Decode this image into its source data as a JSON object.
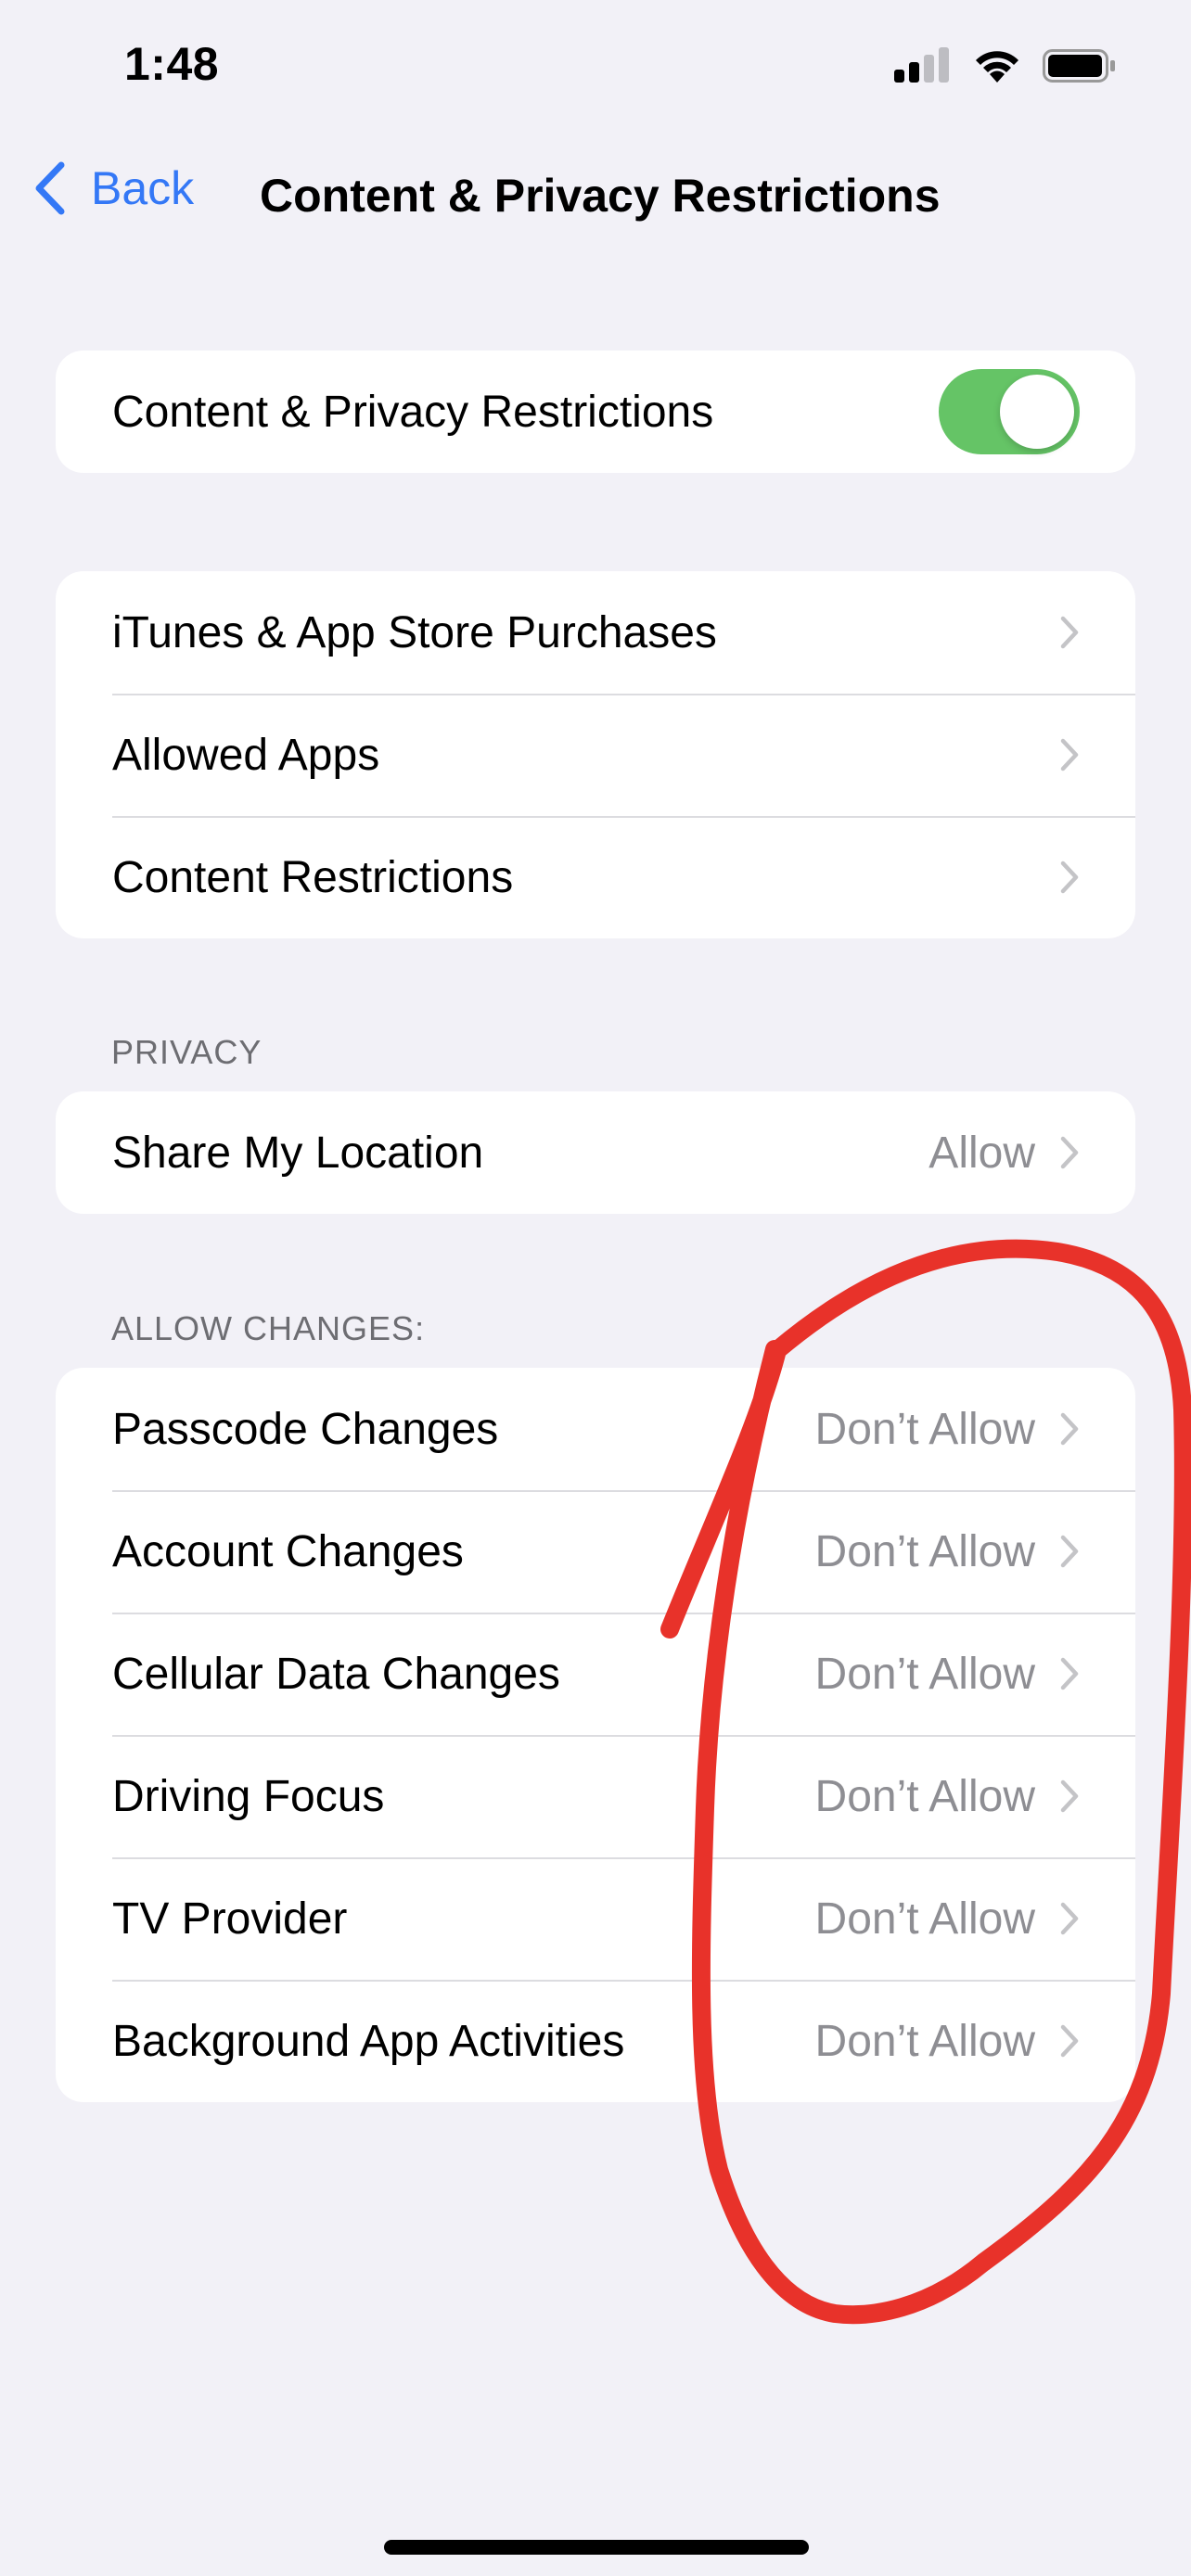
{
  "status_bar": {
    "time": "1:48",
    "icons": [
      "cellular-signal-icon",
      "wifi-icon",
      "battery-icon"
    ]
  },
  "nav": {
    "back_label": "Back",
    "title": "Content & Privacy Restrictions"
  },
  "master_toggle": {
    "label": "Content & Privacy Restrictions",
    "on": true,
    "on_color": "#65c466"
  },
  "main_items": [
    {
      "label": "iTunes & App Store Purchases"
    },
    {
      "label": "Allowed Apps"
    },
    {
      "label": "Content Restrictions"
    }
  ],
  "privacy": {
    "header": "PRIVACY",
    "items": [
      {
        "label": "Share My Location",
        "value": "Allow"
      }
    ]
  },
  "allow_changes": {
    "header": "ALLOW CHANGES:",
    "items": [
      {
        "label": "Passcode Changes",
        "value": "Don’t Allow"
      },
      {
        "label": "Account Changes",
        "value": "Don’t Allow"
      },
      {
        "label": "Cellular Data Changes",
        "value": "Don’t Allow"
      },
      {
        "label": "Driving Focus",
        "value": "Don’t Allow"
      },
      {
        "label": "TV Provider",
        "value": "Don’t Allow"
      },
      {
        "label": "Background App Activities",
        "value": "Don’t Allow"
      }
    ]
  },
  "colors": {
    "accent": "#3478f6",
    "background": "#f2f1f7",
    "secondary_text": "#8e8e93",
    "annotation": "#e8322a"
  }
}
